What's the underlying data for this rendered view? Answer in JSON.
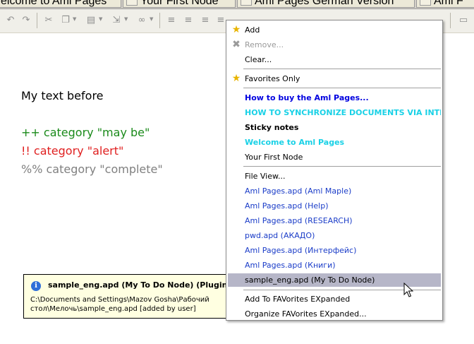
{
  "tabs": [
    {
      "label": "elcome to Aml Pages"
    },
    {
      "label": "Your First Node"
    },
    {
      "label": "Aml Pages German Version"
    },
    {
      "label": "Aml F"
    }
  ],
  "document": {
    "lines": [
      {
        "text": "My text before",
        "color": "#000000"
      },
      {
        "text": "++ category \"may be\"",
        "color": "#1a8a1a"
      },
      {
        "text": "!! category \"alert\"",
        "color": "#e02020"
      },
      {
        "text": "%% category \"complete\"",
        "color": "#808080"
      }
    ]
  },
  "tooltip": {
    "icon": "info-icon",
    "title": "sample_eng.apd (My To Do Node) (Plugins)",
    "body": "C:\\Documents and Settings\\Mazov Gosha\\Рабочий стол\\Мелочь\\sample_eng.apd [added by user]"
  },
  "menu": {
    "add": {
      "label": "Add",
      "icon": "star-icon"
    },
    "remove": {
      "label": "Remove...",
      "icon": "x-icon"
    },
    "clear": {
      "label": "Clear..."
    },
    "favorites_only": {
      "label": "Favorites Only",
      "icon": "star-icon"
    },
    "favorites": [
      {
        "label": "How to buy the Aml Pages...",
        "style": "bold blue"
      },
      {
        "label": "HOW TO SYNCHRONIZE DOCUMENTS VIA INTERNET",
        "style": "bold cyan"
      },
      {
        "label": "Sticky notes",
        "style": "bold"
      },
      {
        "label": "Welcome to Aml Pages",
        "style": "bold cyan"
      },
      {
        "label": "Your First Node",
        "style": ""
      }
    ],
    "file_view": {
      "label": "File View..."
    },
    "files": [
      {
        "label": "Aml Pages.apd (Aml Maple)"
      },
      {
        "label": "Aml Pages.apd (Help)"
      },
      {
        "label": "Aml Pages.apd (RESEARCH)"
      },
      {
        "label": "pwd.apd (АКАДО)"
      },
      {
        "label": "Aml Pages.apd (Интерфейс)"
      },
      {
        "label": "Aml Pages.apd (Книги)"
      },
      {
        "label": "sample_eng.apd (My To Do Node)"
      }
    ],
    "add_expanded": {
      "label": "Add To FAVorites EXpanded"
    },
    "organize_expanded": {
      "label": "Organize FAVorites EXpanded..."
    }
  },
  "colors": {
    "highlight": "#b6b6c8",
    "tooltip_bg": "#ffffe1"
  }
}
